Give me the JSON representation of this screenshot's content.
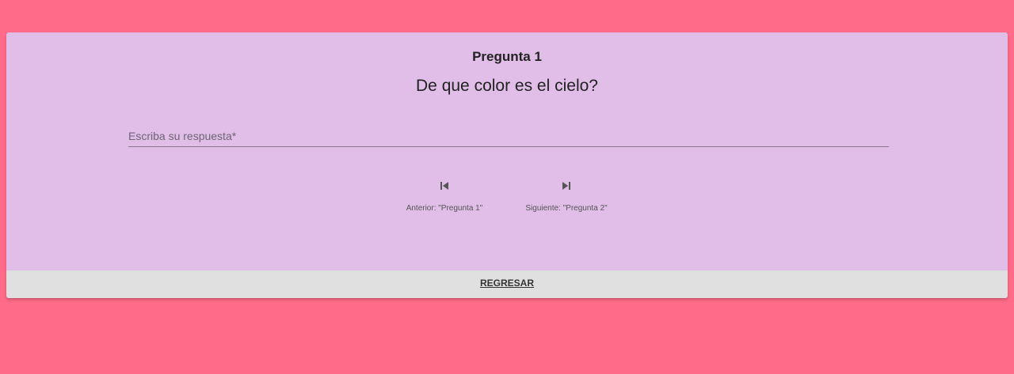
{
  "question": {
    "title": "Pregunta 1",
    "text": "De que color es el cielo?"
  },
  "answer": {
    "placeholder": "Escriba su respuesta*",
    "value": ""
  },
  "navigation": {
    "previous_label": "Anterior: \"Pregunta 1\"",
    "previous_icon": "skip-previous-icon",
    "next_label": "Siguiente: \"Pregunta 2\"",
    "next_icon": "skip-next-icon"
  },
  "footer": {
    "back_label": "REGRESAR"
  },
  "colors": {
    "background": "#ff6b88",
    "card": "#e0bee8",
    "footer": "#e0e0e0"
  }
}
